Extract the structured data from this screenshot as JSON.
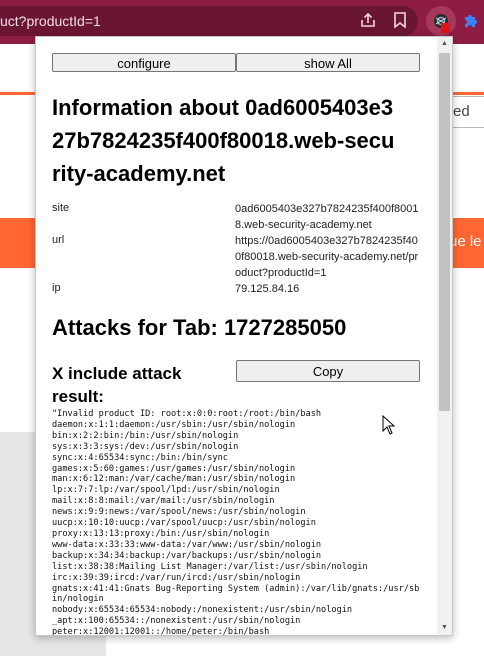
{
  "browser": {
    "url_fragment": "uct?productId=1"
  },
  "background_page": {
    "input_value": "ed",
    "banner_text": "ue le"
  },
  "popup": {
    "configure_label": "configure",
    "show_all_label": "show All",
    "info_heading": "Information about 0ad6005403e327b7824235f400f80018.web-security-academy.net",
    "site_label": "site",
    "site_value": "0ad6005403e327b7824235f400f80018.web-security-academy.net",
    "url_label": "url",
    "url_value": "https://0ad6005403e327b7824235f400f80018.web-security-academy.net/product?productId=1",
    "ip_label": "ip",
    "ip_value": "79.125.84.16",
    "attacks_heading": "Attacks for Tab: 1727285050",
    "x_include_heading": "X include attack result:",
    "copy_label": "Copy",
    "result_text": "\"Invalid product ID: root:x:0:0:root:/root:/bin/bash\ndaemon:x:1:1:daemon:/usr/sbin:/usr/sbin/nologin\nbin:x:2:2:bin:/bin:/usr/sbin/nologin\nsys:x:3:3:sys:/dev:/usr/sbin/nologin\nsync:x:4:65534:sync:/bin:/bin/sync\ngames:x:5:60:games:/usr/games:/usr/sbin/nologin\nman:x:6:12:man:/var/cache/man:/usr/sbin/nologin\nlp:x:7:7:lp:/var/spool/lpd:/usr/sbin/nologin\nmail:x:8:8:mail:/var/mail:/usr/sbin/nologin\nnews:x:9:9:news:/var/spool/news:/usr/sbin/nologin\nuucp:x:10:10:uucp:/var/spool/uucp:/usr/sbin/nologin\nproxy:x:13:13:proxy:/bin:/usr/sbin/nologin\nwww-data:x:33:33:www-data:/var/www:/usr/sbin/nologin\nbackup:x:34:34:backup:/var/backups:/usr/sbin/nologin\nlist:x:38:38:Mailing List Manager:/var/list:/usr/sbin/nologin\nirc:x:39:39:ircd:/var/run/ircd:/usr/sbin/nologin\ngnats:x:41:41:Gnats Bug-Reporting System (admin):/var/lib/gnats:/usr/sbin/nologin\nnobody:x:65534:65534:nobody:/nonexistent:/usr/sbin/nologin\n_apt:x:100:65534::/nonexistent:/usr/sbin/nologin\npeter:x:12001:12001::/home/peter:/bin/bash"
  },
  "icons": [
    "share-icon",
    "bookmark-icon",
    "extension-icon",
    "puzzle-icon",
    "cursor-icon"
  ],
  "colors": {
    "browser_frame": "#8d1d44",
    "accent_orange": "#ff6633",
    "badge_red": "#e01515",
    "puzzle_blue": "#3b82f6"
  }
}
